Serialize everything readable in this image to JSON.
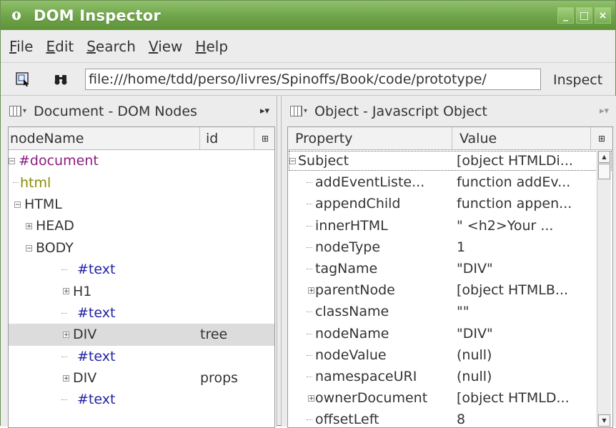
{
  "window": {
    "title": "DOM Inspector"
  },
  "menu": [
    {
      "label": "File",
      "accel": "F",
      "rest": "ile"
    },
    {
      "label": "Edit",
      "accel": "E",
      "rest": "dit"
    },
    {
      "label": "Search",
      "accel": "S",
      "rest": "earch"
    },
    {
      "label": "View",
      "accel": "V",
      "rest": "iew"
    },
    {
      "label": "Help",
      "accel": "H",
      "rest": "elp"
    }
  ],
  "toolbar": {
    "url": "file:///home/tdd/perso/livres/Spinoffs/Book/code/prototype/",
    "inspect_label": "Inspect"
  },
  "left_pane": {
    "title": "Document - DOM Nodes",
    "more": "▸▾",
    "columns": {
      "name": "nodeName",
      "id": "id"
    },
    "rows": [
      {
        "label": "#document",
        "kind": "doc",
        "indent": 0,
        "expander": "−",
        "id": ""
      },
      {
        "label": "html",
        "kind": "dtd",
        "indent": 1,
        "expander": "",
        "id": ""
      },
      {
        "label": "HTML",
        "kind": "el",
        "indent": 1,
        "expander": "−",
        "id": ""
      },
      {
        "label": "HEAD",
        "kind": "el",
        "indent": 2,
        "expander": "+",
        "id": ""
      },
      {
        "label": "BODY",
        "kind": "el",
        "indent": 2,
        "expander": "−",
        "id": ""
      },
      {
        "label": "#text",
        "kind": "text",
        "indent": 3,
        "expander": "",
        "id": ""
      },
      {
        "label": "H1",
        "kind": "el",
        "indent": 3,
        "expander": "+",
        "id": ""
      },
      {
        "label": "#text",
        "kind": "text",
        "indent": 3,
        "expander": "",
        "id": ""
      },
      {
        "label": "DIV",
        "kind": "el",
        "indent": 3,
        "expander": "+",
        "id": "tree",
        "selected": true
      },
      {
        "label": "#text",
        "kind": "text",
        "indent": 3,
        "expander": "",
        "id": ""
      },
      {
        "label": "DIV",
        "kind": "el",
        "indent": 3,
        "expander": "+",
        "id": "props"
      },
      {
        "label": "#text",
        "kind": "text",
        "indent": 3,
        "expander": "",
        "id": ""
      }
    ]
  },
  "right_pane": {
    "title": "Object - Javascript Object",
    "more": "▸▾",
    "columns": {
      "property": "Property",
      "value": "Value"
    },
    "rows": [
      {
        "name": "Subject",
        "value": "[object HTMLDi...",
        "indent": 0,
        "expander": "−"
      },
      {
        "name": "addEventListe...",
        "value": "function addEv...",
        "indent": 1,
        "expander": ""
      },
      {
        "name": "appendChild",
        "value": "function appen...",
        "indent": 1,
        "expander": ""
      },
      {
        "name": "innerHTML",
        "value": "\"     <h2>Your ...",
        "indent": 1,
        "expander": ""
      },
      {
        "name": "nodeType",
        "value": "1",
        "indent": 1,
        "expander": ""
      },
      {
        "name": "tagName",
        "value": "\"DIV\"",
        "indent": 1,
        "expander": ""
      },
      {
        "name": "parentNode",
        "value": "[object HTMLB...",
        "indent": 1,
        "expander": "+"
      },
      {
        "name": "className",
        "value": "\"\"",
        "indent": 1,
        "expander": ""
      },
      {
        "name": "nodeName",
        "value": "\"DIV\"",
        "indent": 1,
        "expander": ""
      },
      {
        "name": "nodeValue",
        "value": "(null)",
        "indent": 1,
        "expander": ""
      },
      {
        "name": "namespaceURI",
        "value": "(null)",
        "indent": 1,
        "expander": ""
      },
      {
        "name": "ownerDocument",
        "value": "[object HTMLD...",
        "indent": 1,
        "expander": "+"
      },
      {
        "name": "offsetLeft",
        "value": "8",
        "indent": 1,
        "expander": ""
      }
    ]
  },
  "colors": {
    "titlebar": "#6ea349",
    "document_node": "#8b1c7e",
    "doctype_node": "#8b8b00",
    "text_node": "#2222a6",
    "selected_row": "#dcdcdc"
  }
}
